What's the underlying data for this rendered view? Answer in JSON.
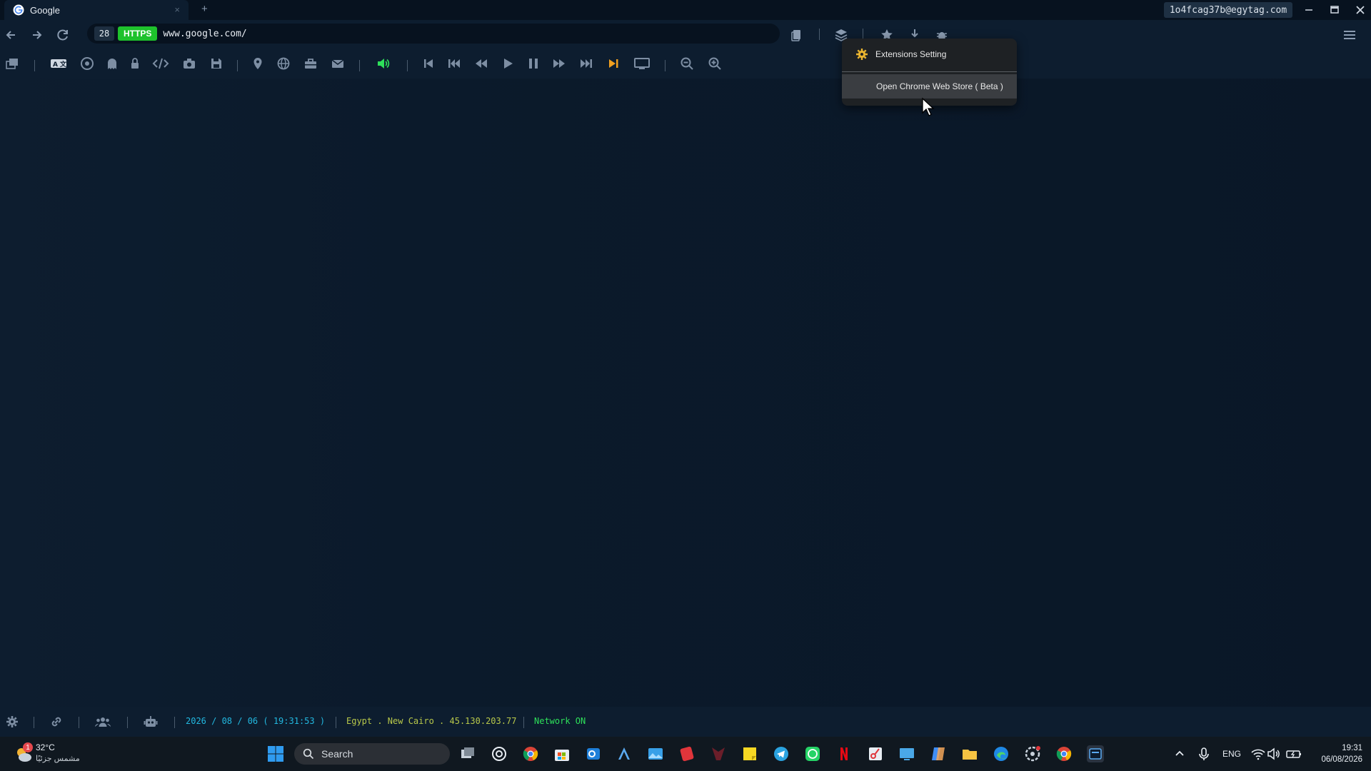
{
  "tab": {
    "title": "Google",
    "close_glyph": "×"
  },
  "new_tab_glyph": "+",
  "account": {
    "email": "1o4fcag37b@egytag.com"
  },
  "address_bar": {
    "tab_count": "28",
    "protocol": "HTTPS",
    "url": "www.google.com/"
  },
  "colors": {
    "accent_green": "#1ec22c",
    "status_cyan": "#22b8e0",
    "status_olive": "#b8c84a",
    "status_green": "#2ee05a",
    "orange": "#f0a020"
  },
  "menu": {
    "items": [
      {
        "label": "Extensions Setting",
        "icon": "gear-icon"
      },
      {
        "label": "Open Chrome Web Store ( Beta )"
      }
    ]
  },
  "status": {
    "datetime": "2026 / 08 / 06 ( 19:31:53 )",
    "location": "Egypt . New Cairo . 45.130.203.77",
    "network": "Network ON"
  },
  "taskbar": {
    "weather_temp": "32°C",
    "weather_desc": "مشمس جزئيًا",
    "weather_badge": "1",
    "search_label": "Search",
    "lang": "ENG",
    "time": "19:31",
    "date": "06/08/2026"
  }
}
